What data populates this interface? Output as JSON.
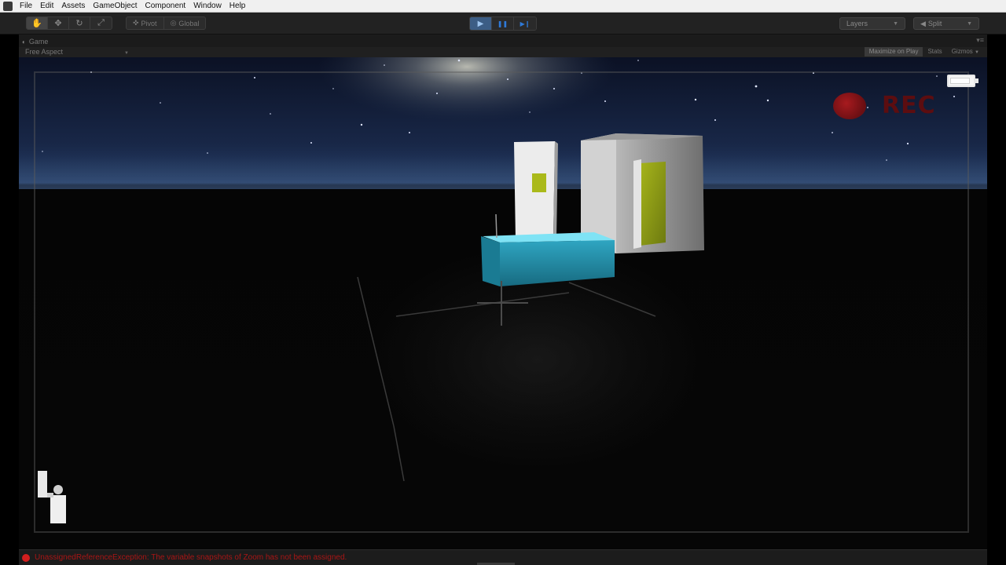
{
  "menubar": {
    "items": [
      "File",
      "Edit",
      "Assets",
      "GameObject",
      "Component",
      "Window",
      "Help"
    ]
  },
  "toolbar": {
    "transform_tools": [
      {
        "icon": "hand-icon",
        "glyph": "✋"
      },
      {
        "icon": "move-icon",
        "glyph": "✥"
      },
      {
        "icon": "rotate-icon",
        "glyph": "↻"
      },
      {
        "icon": "scale-icon",
        "glyph": "⤢"
      }
    ],
    "pivot_label": "Pivot",
    "global_label": "Global",
    "play_controls": [
      {
        "icon": "play-icon",
        "glyph": "▶",
        "active": true
      },
      {
        "icon": "pause-icon",
        "glyph": "❚❚",
        "active": false
      },
      {
        "icon": "step-icon",
        "glyph": "▶❙",
        "active": false
      }
    ],
    "layers_label": "Layers",
    "layout_label": "Split"
  },
  "game_panel": {
    "tab_label": "Game",
    "aspect_label": "Free Aspect",
    "maximize_label": "Maximize on Play",
    "stats_label": "Stats",
    "gizmos_label": "Gizmos"
  },
  "overlay": {
    "rec_label": "REC",
    "battery_level": 0.9
  },
  "colors": {
    "accent_play": "#3c5d85",
    "error_red": "#a81515",
    "rec_red": "#c21a1a"
  },
  "statusbar": {
    "message": "UnassignedReferenceException: The variable snapshots of Zoom has not been assigned."
  }
}
